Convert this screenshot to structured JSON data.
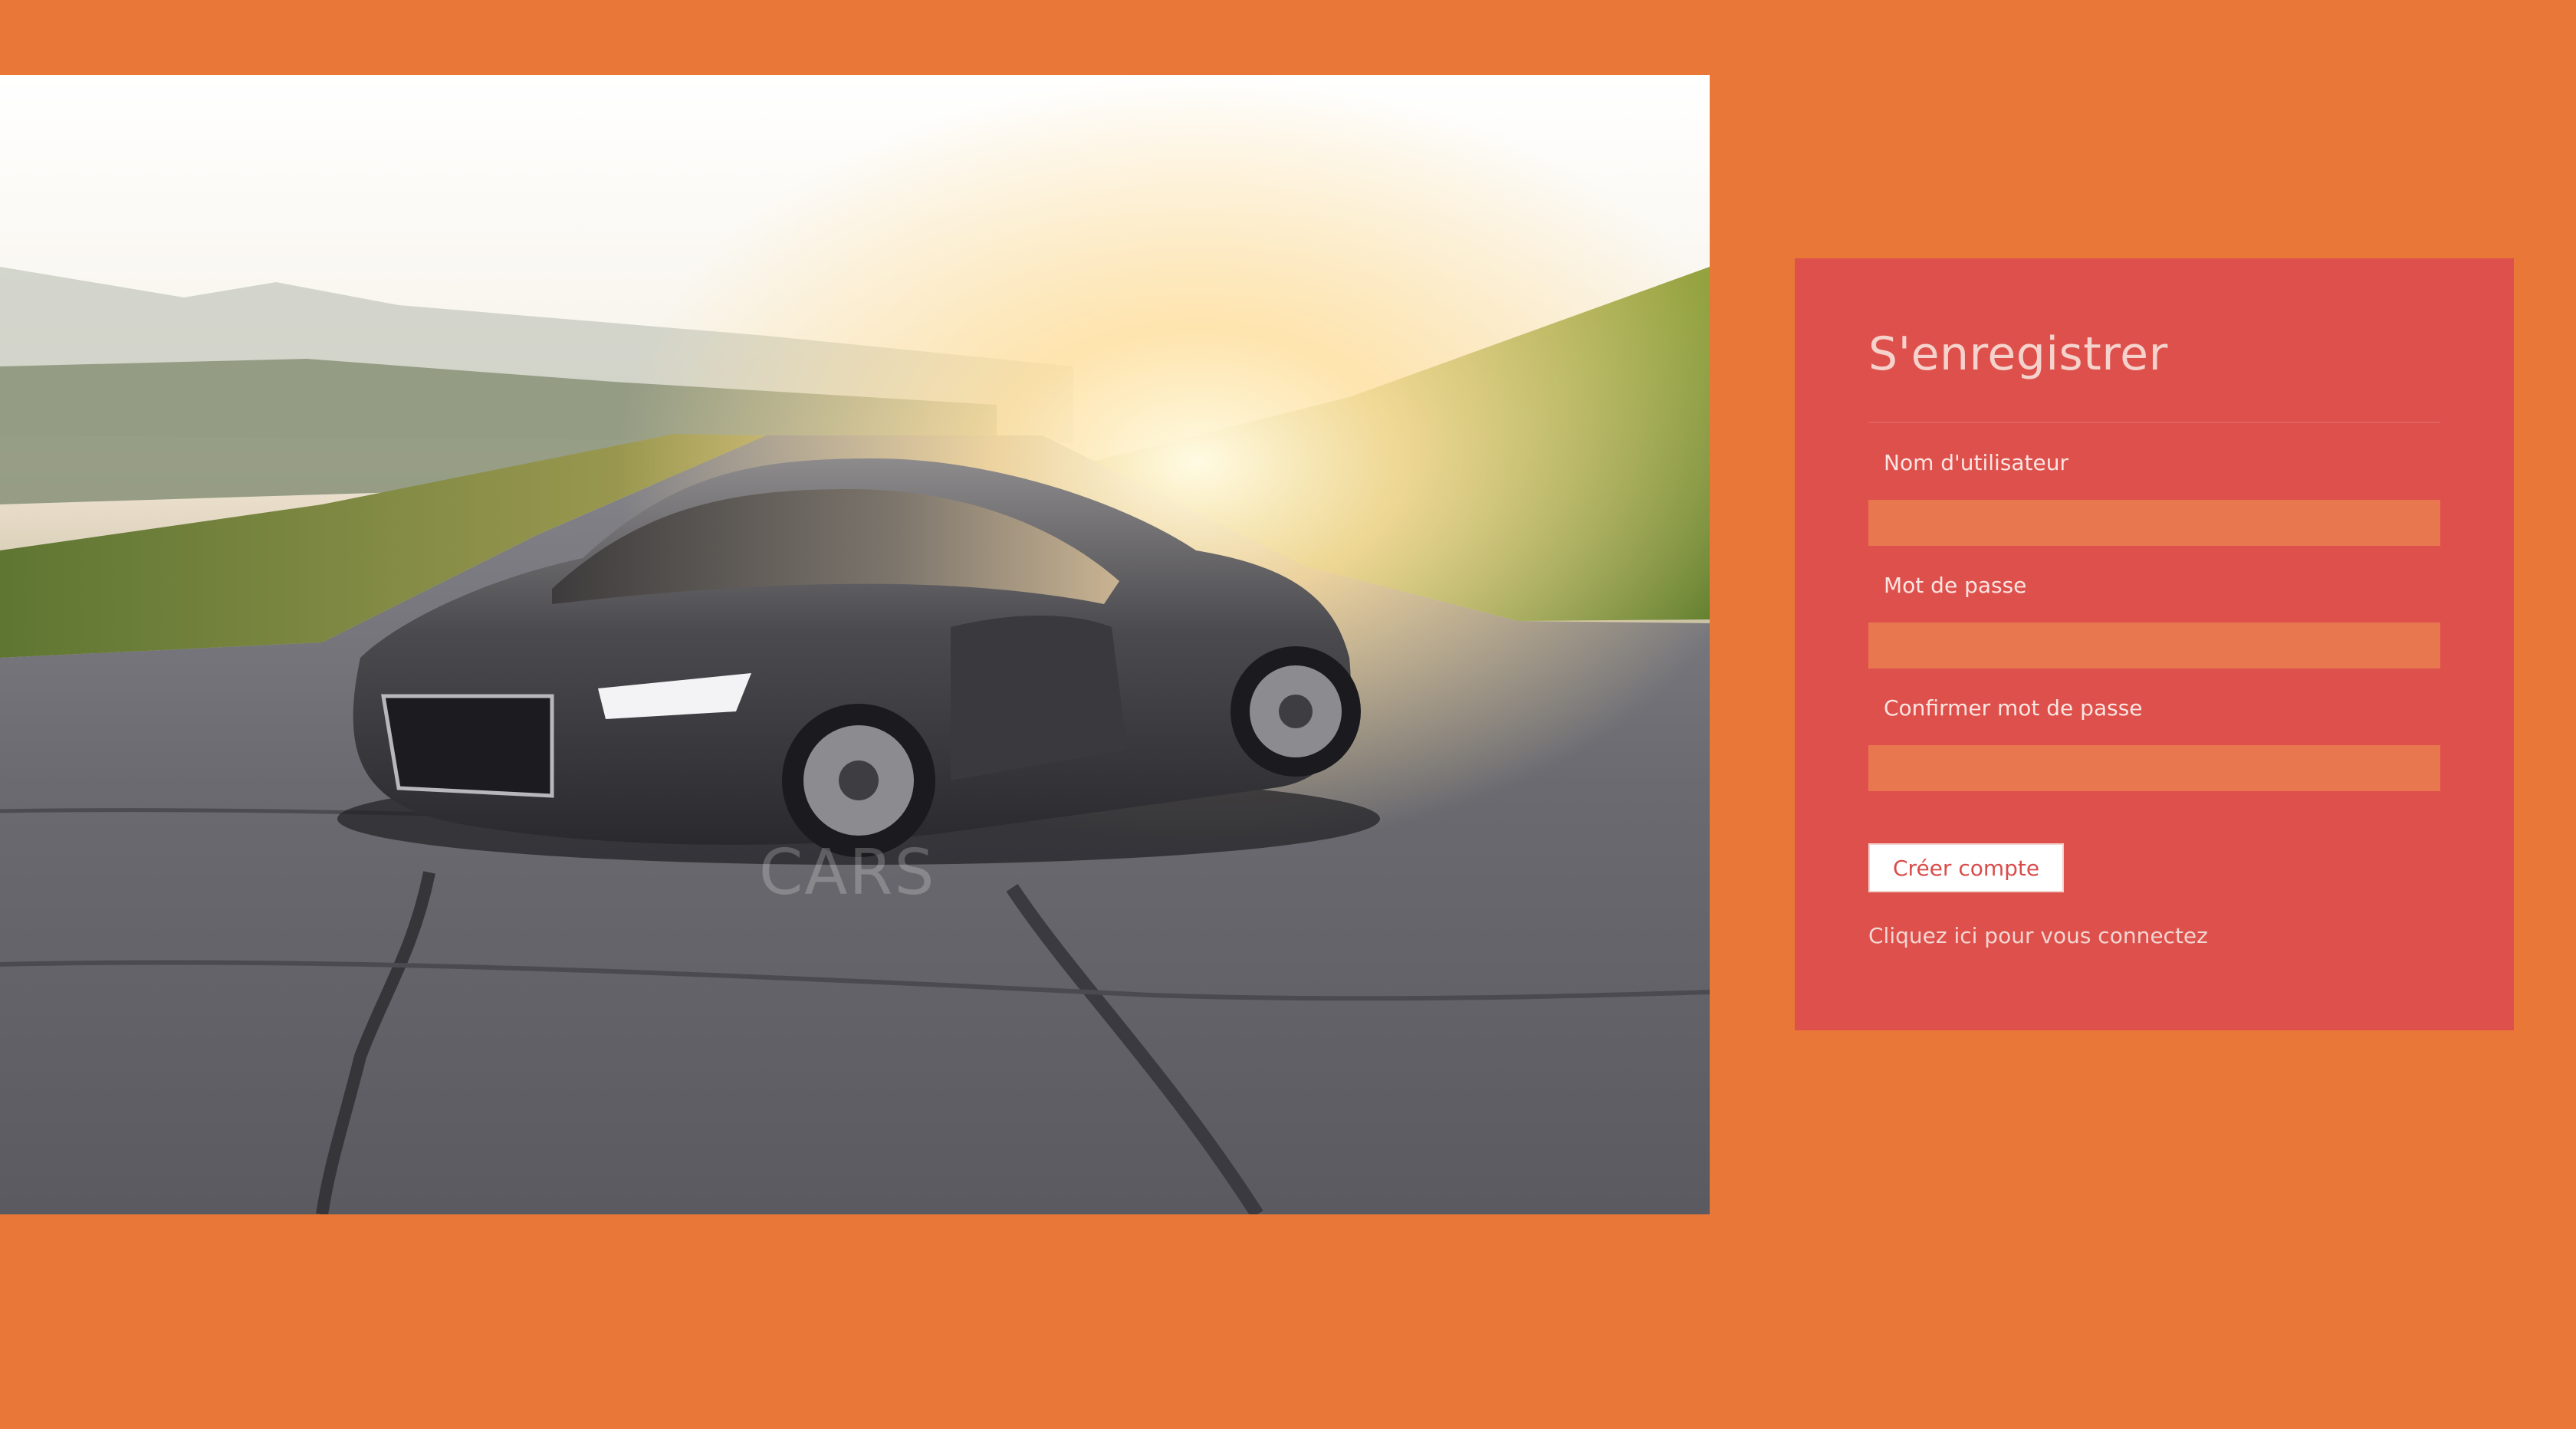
{
  "colors": {
    "background": "#e97737",
    "panel": "#de504b",
    "input": "#e87750",
    "button_text": "#d94c4a"
  },
  "hero": {
    "caption": "CARS"
  },
  "register": {
    "title": "S'enregistrer",
    "username_label": "Nom d'utilisateur",
    "username_value": "",
    "password_label": "Mot de passe",
    "password_value": "",
    "confirm_label": "Confirmer mot de passe",
    "confirm_value": "",
    "submit_label": "Créer compte",
    "login_link": "Cliquez ici pour vous connectez"
  }
}
